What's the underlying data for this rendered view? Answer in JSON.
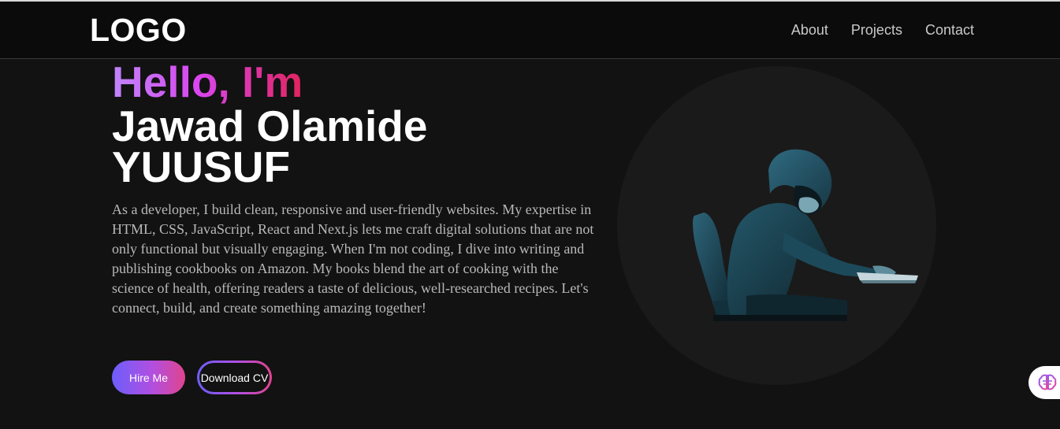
{
  "navbar": {
    "logo": "LOGO",
    "links": [
      "About",
      "Projects",
      "Contact"
    ]
  },
  "hero": {
    "greeting": "Hello, I'm",
    "name_line1": "Jawad Olamide",
    "name_line2": "YUUSUF",
    "bio": "As a developer, I build clean, responsive and user-friendly websites. My expertise in HTML, CSS, JavaScript, React and Next.js lets me craft digital solutions that are not only functional but visually engaging. When I'm not coding, I dive into writing and publishing cookbooks on Amazon. My books blend the art of cooking with the science of health, offering readers a taste of delicious, well-researched recipes. Let's connect, build, and create something amazing together!",
    "buttons": {
      "hire": "Hire Me",
      "download_cv": "Download CV"
    }
  },
  "colors": {
    "background": "#121212",
    "navbar": "#0b0b0b",
    "gradient_start": "#6d5efc",
    "gradient_end": "#e0448e",
    "greeting_start": "#c084fc",
    "greeting_end": "#e0245e"
  },
  "icons": {
    "fab": "brain-icon",
    "hero_image": "hooded-hacker-illustration"
  }
}
